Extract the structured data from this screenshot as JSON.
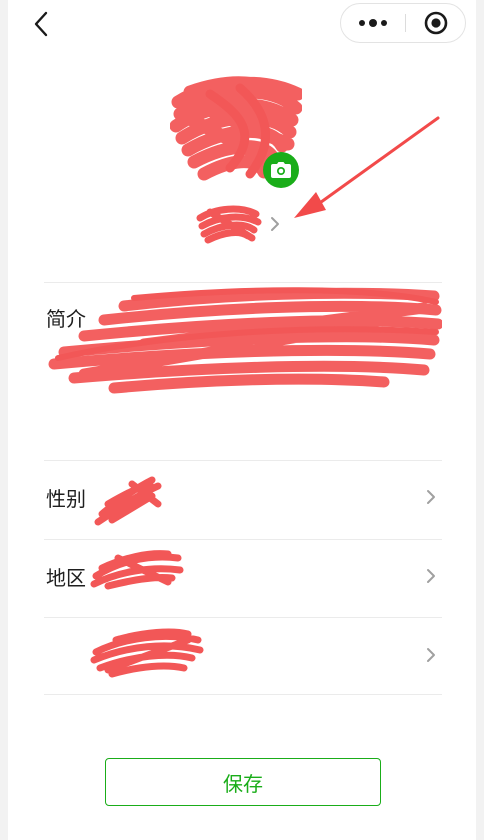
{
  "header": {
    "back_icon": "chevron-left-icon",
    "more_icon": "more-dots-icon",
    "close_icon": "target-circle-icon"
  },
  "profile": {
    "avatar_state": "redacted",
    "camera_icon": "camera-icon",
    "nickname_state": "redacted",
    "accent_color": "#1aad19",
    "annotation_arrow_color": "#f24a4a"
  },
  "form": {
    "bio_label": "简介",
    "gender_label": "性别",
    "region_label": "地区",
    "chevron_icon": "chevron-right-icon"
  },
  "actions": {
    "save_label": "保存"
  }
}
